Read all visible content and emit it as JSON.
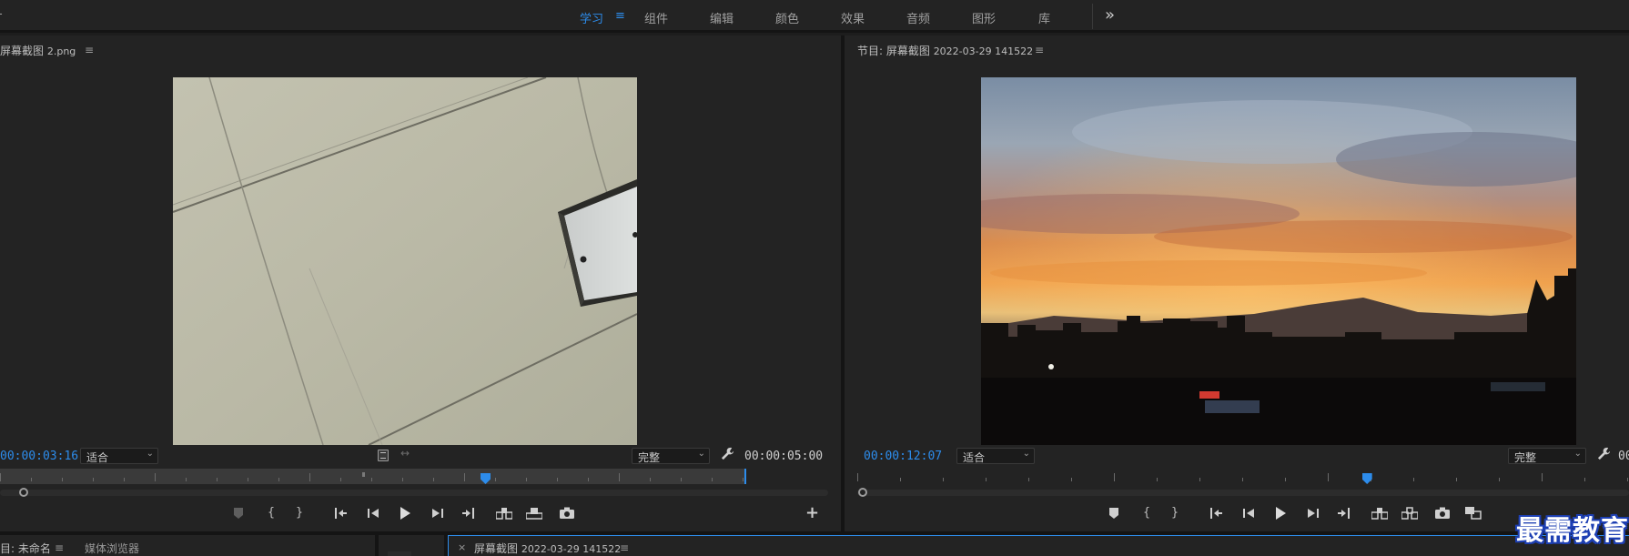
{
  "workspaces": {
    "items": [
      {
        "label": "学习",
        "active": true
      },
      {
        "label": "组件"
      },
      {
        "label": "编辑"
      },
      {
        "label": "颜色"
      },
      {
        "label": "效果"
      },
      {
        "label": "音频"
      },
      {
        "label": "图形"
      },
      {
        "label": "库"
      }
    ],
    "more": "»"
  },
  "source_monitor": {
    "title": "屏幕截图",
    "title_suffix": "2.png",
    "current_timecode": "00:00:03:16",
    "zoom": "适合",
    "quality": "完整",
    "duration": "00:00:05:00",
    "playhead_fraction": 0.65
  },
  "program_monitor": {
    "title": "节目: 屏幕截图",
    "title_suffix": "2022-03-29 141522",
    "current_timecode": "00:00:12:07",
    "zoom": "适合",
    "quality": "完整",
    "duration_fragment": "00",
    "playhead_fraction": 0.66
  },
  "bottom_left": {
    "project_label": "目: 未命名",
    "media_browser": "媒体浏览器"
  },
  "timeline": {
    "close": "×",
    "title": "屏幕截图",
    "title_suffix": "2022-03-29 141522"
  },
  "menu_glyph": "≡",
  "watermark": "最需教育",
  "colors": {
    "accent": "#2d8ceb",
    "panel_bg": "#232323",
    "divider": "#141414"
  }
}
